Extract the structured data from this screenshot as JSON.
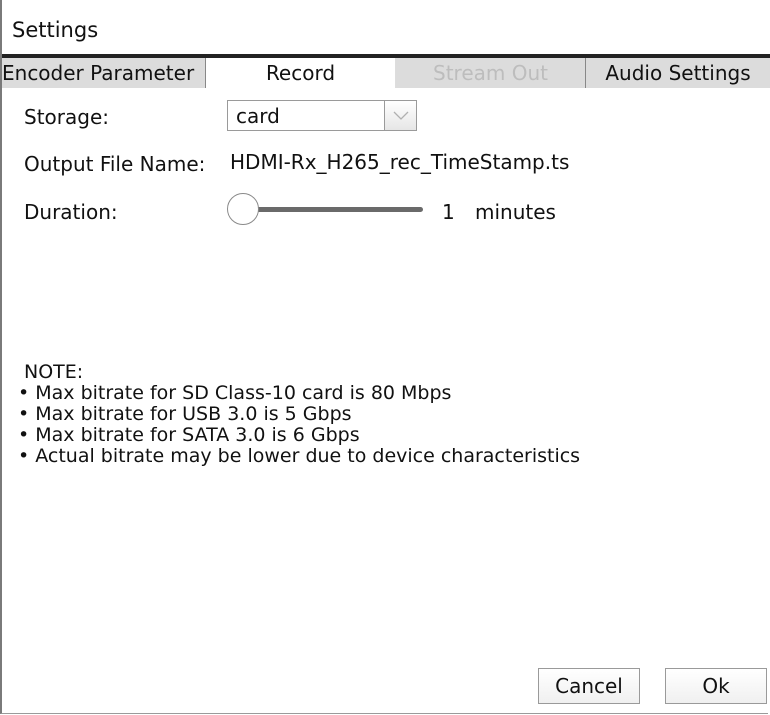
{
  "dialog": {
    "title": "Settings"
  },
  "tabs": [
    {
      "label": "Encoder Parameter",
      "state": "normal"
    },
    {
      "label": "Record",
      "state": "active"
    },
    {
      "label": "Stream Out",
      "state": "disabled"
    },
    {
      "label": "Audio Settings",
      "state": "normal"
    }
  ],
  "form": {
    "storage_label": "Storage:",
    "storage_value": "card",
    "output_label": "Output File Name:",
    "output_value": "HDMI-Rx_H265_rec_TimeStamp.ts",
    "duration_label": "Duration:",
    "duration_value": "1",
    "duration_unit": "minutes",
    "duration_slider_level": 0
  },
  "note": {
    "heading": "NOTE:",
    "items": [
      "• Max bitrate for SD Class-10 card is 80 Mbps",
      "• Max bitrate for USB 3.0 is 5 Gbps",
      "• Max bitrate for SATA 3.0 is 6 Gbps",
      "• Actual bitrate may be lower due to device characteristics"
    ]
  },
  "buttons": {
    "cancel": "Cancel",
    "ok": "Ok"
  },
  "icons": {
    "dropdown": "chevron-down-icon"
  },
  "colors": {
    "tab_inactive_bg": "#dcdcdc",
    "tab_disabled_text": "#bdbdbd",
    "title_rule": "#222222"
  }
}
